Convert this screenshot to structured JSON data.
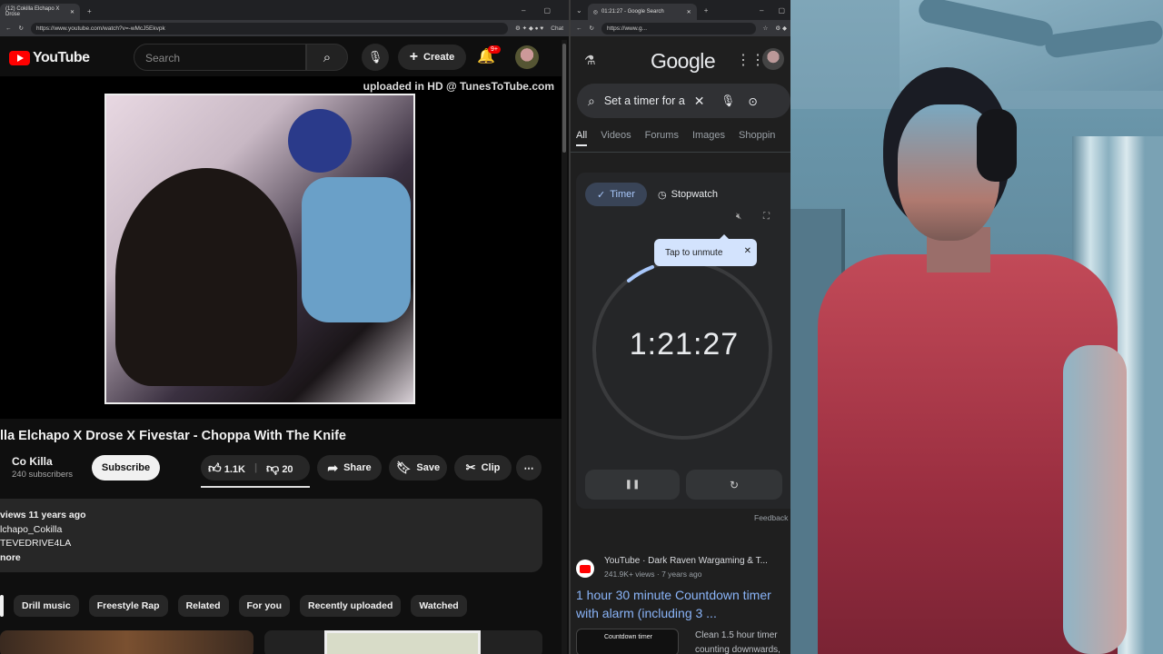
{
  "youtube": {
    "tab_title": "(12) Cokilla Elchapo X Drose",
    "url": "https://www.youtube.com/watch?v=-wMcJ5Ekvpk",
    "chat_label": "Chat",
    "logo_text": "YouTube",
    "search_placeholder": "Search",
    "create_label": "Create",
    "notif_badge": "9+",
    "watermark": "uploaded in HD @ TunesToTube.com",
    "video_title": "illa Elchapo X Drose X Fivestar - Choppa With The Knife",
    "channel_name": "Co Killa",
    "subscribers": "240 subscribers",
    "subscribe_label": "Subscribe",
    "likes": "1.1K",
    "dislikes": "20",
    "share_label": "Share",
    "save_label": "Save",
    "clip_label": "Clip",
    "desc_views": "views  11 years ago",
    "desc_line2": "lchapo_Cokilla",
    "desc_line3": "TEVEDRIVE4LA",
    "desc_more": "nore",
    "chips": [
      "Drill music",
      "Freestyle Rap",
      "Related",
      "For you",
      "Recently uploaded",
      "Watched"
    ]
  },
  "google": {
    "tab_title": "01:21:27 - Google Search",
    "url": "https://www.g...",
    "logo_text": "Google",
    "search_value": "Set a timer for a",
    "tabs": [
      "All",
      "Videos",
      "Forums",
      "Images",
      "Shoppin"
    ],
    "timer_label": "Timer",
    "stopwatch_label": "Stopwatch",
    "tooltip": "Tap to unmute",
    "time": "1:21:27",
    "feedback": "Feedback",
    "result_source": "YouTube · Dark Raven Wargaming & T...",
    "result_meta": "241.9K+ views · 7 years ago",
    "result_title": "1 hour 30 minute Countdown timer with alarm (including 3 ...",
    "thumb_text": "Countdown timer",
    "snippet1": "Clean 1.5 hour timer",
    "snippet2": "counting downwards,"
  }
}
